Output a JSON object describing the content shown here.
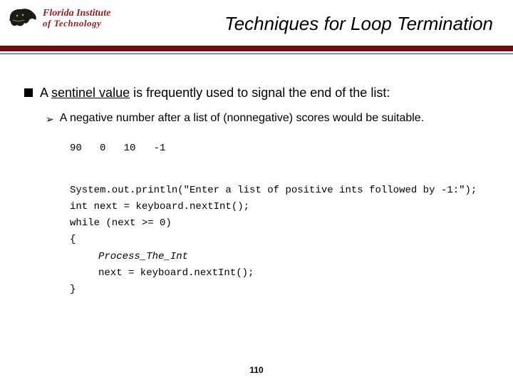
{
  "logo": {
    "line1": "Florida Institute",
    "line2": "of Technology"
  },
  "title": "Techniques for Loop Termination",
  "bullet": {
    "pre": "A ",
    "term": "sentinel value",
    "post": " is frequently used to signal the end of the list:"
  },
  "subbullet": "A negative number after a list of (nonnegative) scores would be suitable.",
  "example_numbers": "90   0   10   -1",
  "code": {
    "l1": "System.out.println(\"Enter a list of positive ints followed by -1:\");",
    "l2": "int next = keyboard.nextInt();",
    "l3": "while (next >= 0)",
    "l4": "{",
    "l5": "Process_The_Int",
    "l6": "next = keyboard.nextInt();",
    "l7": "}"
  },
  "page_number": "110"
}
